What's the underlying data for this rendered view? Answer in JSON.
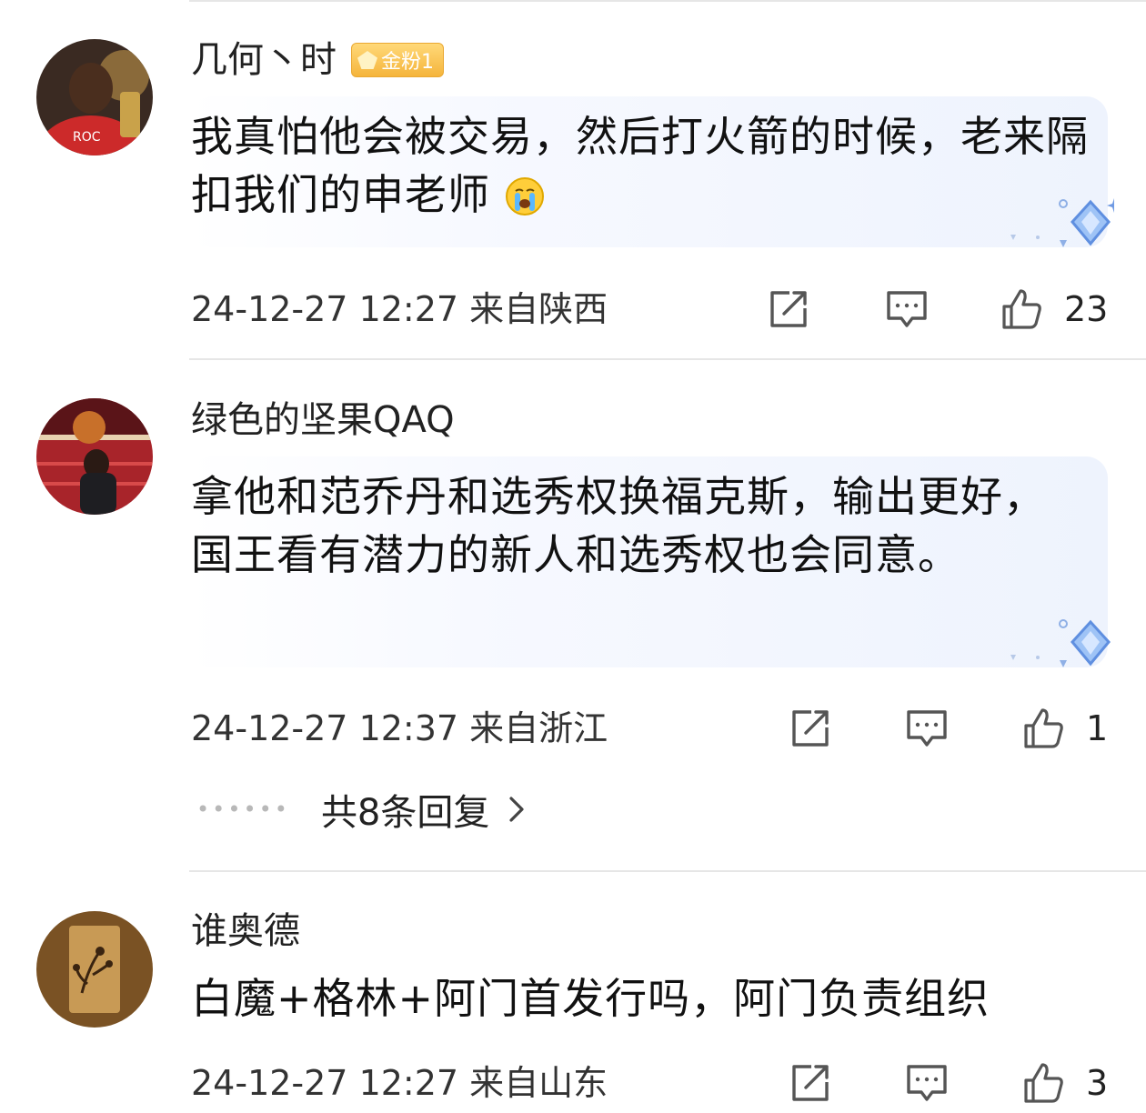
{
  "comments": [
    {
      "username": "几何丶时",
      "badge": "金粉1",
      "text": "我真怕他会被交易，然后打火箭的时候，老来隔扣我们的申老师",
      "emoji": "crying-face-emoji",
      "date": "24-12-27 12:27",
      "location": "来自陕西",
      "likes": "23"
    },
    {
      "username": "绿色的坚果QAQ",
      "text": "拿他和范乔丹和选秀权换福克斯，输出更好，国王看有潜力的新人和选秀权也会同意。",
      "date": "24-12-27 12:37",
      "location": "来自浙江",
      "likes": "1",
      "replies_label": "共8条回复"
    },
    {
      "username": "谁奥德",
      "text": "白魔+格林+阿门首发行吗，阿门负责组织",
      "date": "24-12-27 12:27",
      "location": "来自山东",
      "likes": "3"
    }
  ],
  "icons": {
    "share": "share-icon",
    "comment": "comment-icon",
    "like": "thumbs-up-icon",
    "more": "chevron-right-icon"
  },
  "colors": {
    "badge": "#f5b53c",
    "bubble": "#eef3fd",
    "icon": "#555555",
    "divider": "#e6e6e6"
  }
}
